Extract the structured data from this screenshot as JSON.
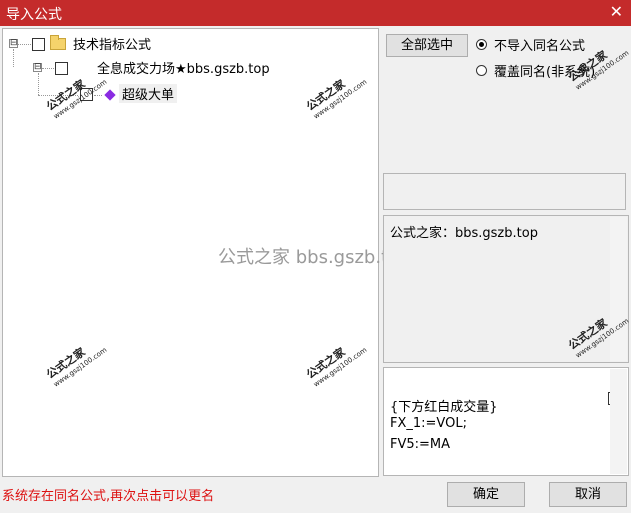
{
  "window": {
    "title": "导入公式",
    "close_glyph": "✕"
  },
  "tree": {
    "root": {
      "label": "技术指标公式",
      "expander": "⊟"
    },
    "child": {
      "label": "全息成交力场★bbs.gszb.top",
      "expander": "⊟"
    },
    "leaf": {
      "label": "超级大单"
    }
  },
  "watermarks": {
    "center": "公式之家 bbs.gszb.top",
    "tile_text": "公式之家",
    "tile_url": "www.gszj100.com"
  },
  "options": {
    "select_all": "全部选中",
    "radio_skip": "不导入同名公式",
    "radio_overwrite": "覆盖同名(非系统)",
    "selected": "radio_skip"
  },
  "info": {
    "text": "公式之家：bbs.gszb.top"
  },
  "code": {
    "lines": [
      "{下方红白成交量}",
      "FX_1:=VOL;",
      "FV5:=MA"
    ]
  },
  "status": {
    "message": "系统存在同名公式,再次点击可以更名"
  },
  "buttons": {
    "ok": "确定",
    "cancel": "取消"
  },
  "colors": {
    "titlebar": "#c42b2b",
    "status_text": "#dd1111"
  }
}
